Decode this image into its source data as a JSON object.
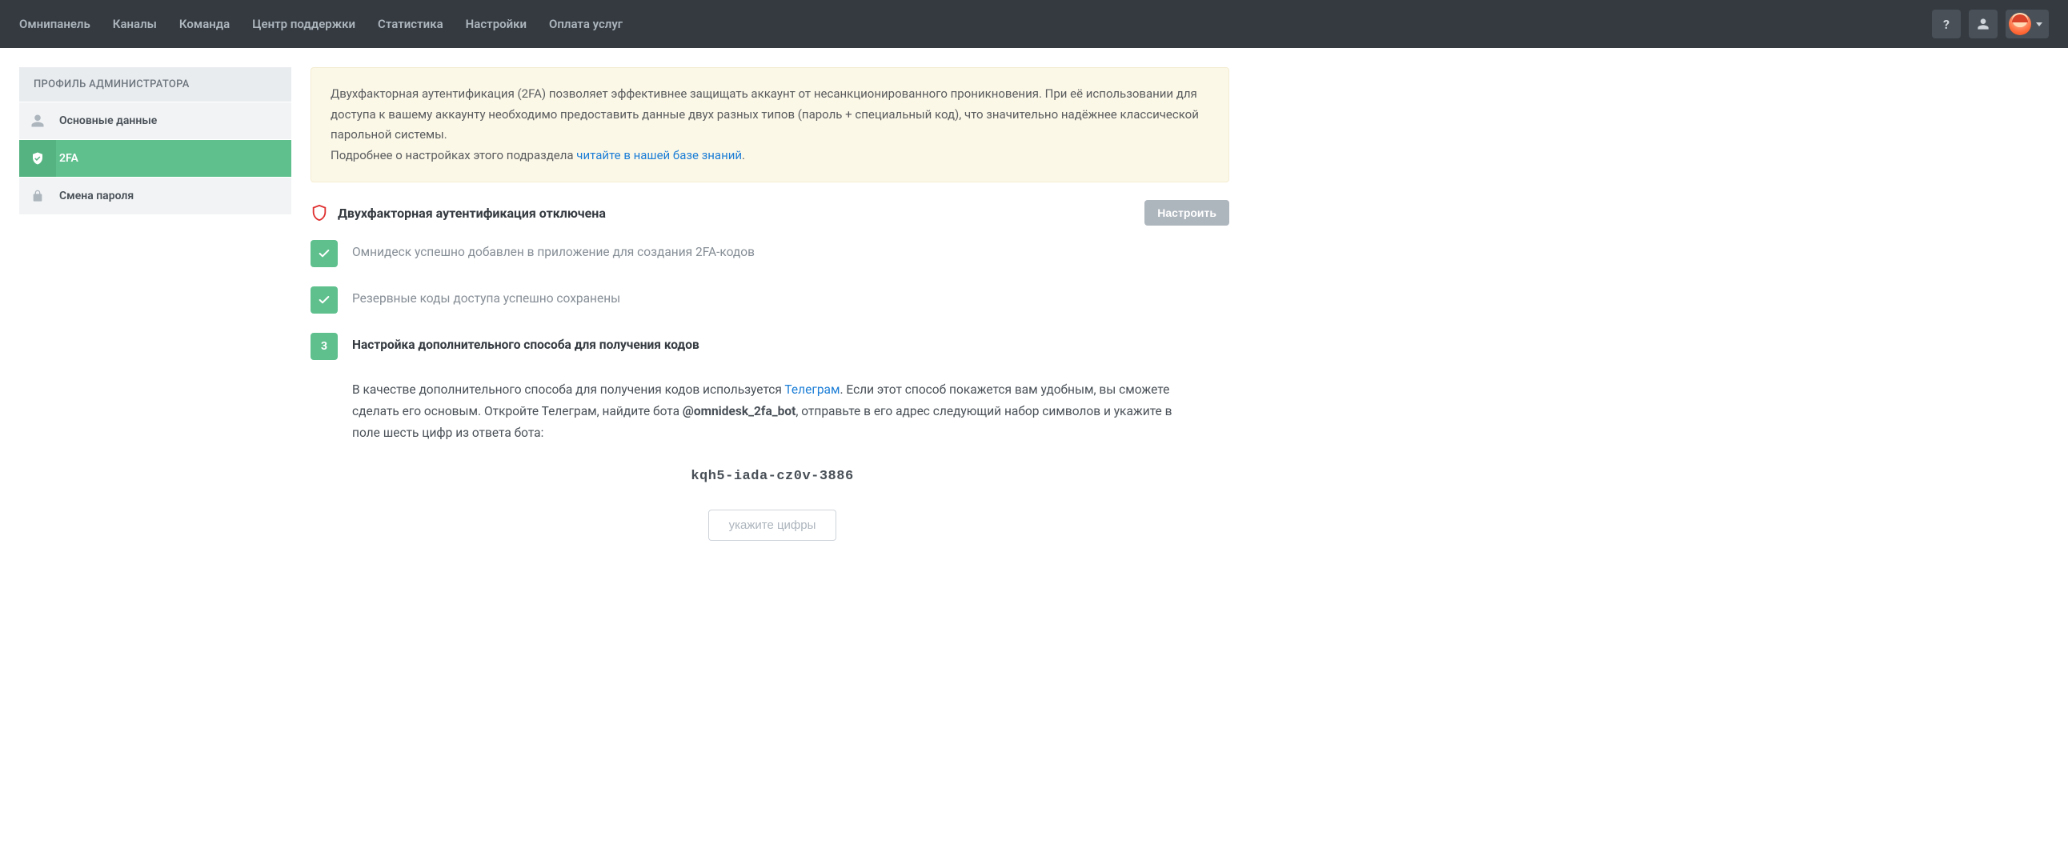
{
  "nav": {
    "items": [
      "Омнипанель",
      "Каналы",
      "Команда",
      "Центр поддержки",
      "Статистика",
      "Настройки",
      "Оплата услуг"
    ],
    "help_glyph": "?"
  },
  "sidebar": {
    "header": "ПРОФИЛЬ АДМИНИСТРАТОРА",
    "items": [
      {
        "label": "Основные данные"
      },
      {
        "label": "2FA"
      },
      {
        "label": "Смена пароля"
      }
    ]
  },
  "notice": {
    "line1": "Двухфакторная аутентификация (2FA) позволяет эффективнее защищать аккаунт от несанкционированного проникновения. При её использовании для доступа к вашему аккаунту необходимо предоставить данные двух разных типов (пароль + специальный код), что значительно надёжнее классической парольной системы.",
    "line2_prefix": "Подробнее о настройках этого подраздела ",
    "line2_link": "читайте в нашей базе знаний",
    "line2_suffix": "."
  },
  "status": {
    "title": "Двухфакторная аутентификация отключена",
    "configure_label": "Настроить"
  },
  "steps": [
    {
      "label": "Омнидеск успешно добавлен в приложение для создания 2FA-кодов"
    },
    {
      "label": "Резервные коды доступа успешно сохранены"
    },
    {
      "number": "3",
      "label": "Настройка дополнительного способа для получения кодов"
    }
  ],
  "step3_body": {
    "part1": "В качестве дополнительного способа для получения кодов используется ",
    "telegram_link": "Телеграм",
    "part2": ". Если этот способ покажется вам удобным, вы сможете сделать его основым. Откройте Телеграм, найдите бота ",
    "bot_name": "@omnidesk_2fa_bot",
    "part3": ", отправьте в его адрес следующий набор символов и укажите в поле шесть цифр из ответа бота:",
    "code": "kqh5-iada-cz0v-3886",
    "input_placeholder": "укажите цифры"
  }
}
